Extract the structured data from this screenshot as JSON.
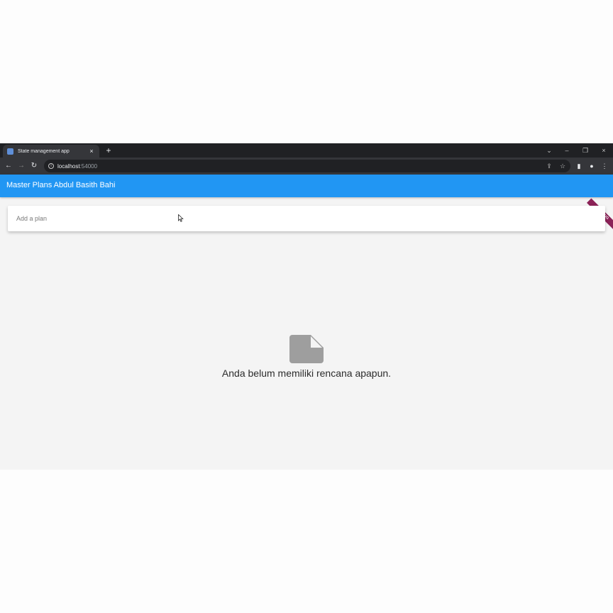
{
  "browser": {
    "tab_title": "State management app",
    "tab_close": "×",
    "new_tab": "+",
    "url_host": "localhost",
    "url_port": ":54000",
    "info_icon": "i",
    "window_controls": {
      "chevron": "⌄",
      "minimize": "–",
      "restore": "❐",
      "close": "×"
    },
    "nav": {
      "back": "←",
      "forward": "→",
      "reload": "↻"
    },
    "toolbar_icons": {
      "share": "⇪",
      "bookmark": "☆",
      "sidepanel": "▮",
      "profile": "●",
      "menu": "⋮"
    }
  },
  "app": {
    "title": "Master Plans Abdul Basith Bahi",
    "debug_label": "DEBUG",
    "accent_color": "#2196f3",
    "input_placeholder": "Add a plan",
    "empty_message": "Anda belum memiliki rencana apapun.",
    "empty_icon": "note-icon"
  }
}
